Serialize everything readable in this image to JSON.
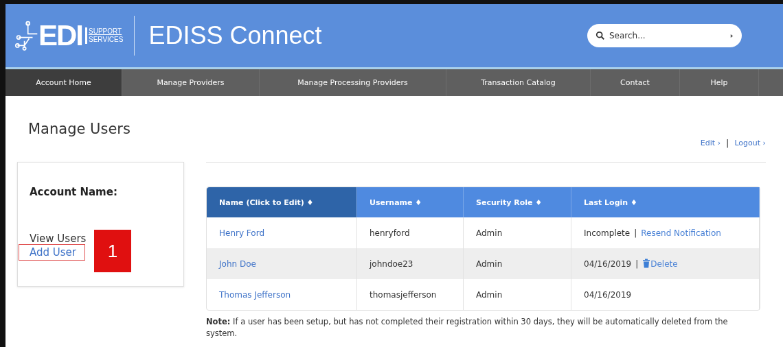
{
  "header": {
    "logo": {
      "main": "EDI",
      "line_1": "SUPPORT",
      "line_2": "SERVICES"
    },
    "title": "EDISS Connect",
    "search": {
      "placeholder": "Search..."
    }
  },
  "nav": [
    {
      "label": "Account Home",
      "selected": true
    },
    {
      "label": "Manage Providers",
      "selected": false
    },
    {
      "label": "Manage Processing Providers",
      "selected": false
    },
    {
      "label": "Transaction Catalog",
      "selected": false
    },
    {
      "label": "Contact",
      "selected": false
    },
    {
      "label": "Help",
      "selected": false
    }
  ],
  "page_title": "Manage Users",
  "top_links": [
    "Edit ›",
    "Logout ›"
  ],
  "top_links_separator": "|",
  "sidebar": {
    "account_label": "Account Name:",
    "links": [
      {
        "label": "View Users",
        "kind": "text",
        "highlighted": false
      },
      {
        "label": "Add User",
        "kind": "link",
        "highlighted": true
      }
    ]
  },
  "callout": "1",
  "table": {
    "columns": [
      {
        "label": "Name (Click to Edit) ♦",
        "selected": true
      },
      {
        "label": "Username ♦",
        "selected": false
      },
      {
        "label": "Security Role ♦",
        "selected": false
      },
      {
        "label": "Last Login ♦",
        "selected": false
      }
    ],
    "rows": [
      {
        "name": "Henry Ford",
        "username": "henryford",
        "role": "Admin",
        "last_login": "Incomplete",
        "action": {
          "kind": "resend",
          "label": "Resend Notification"
        }
      },
      {
        "name": "John Doe",
        "username": "johndoe23",
        "role": "Admin",
        "last_login": "04/16/2019",
        "action": {
          "kind": "delete",
          "label": "Delete"
        }
      },
      {
        "name": "Thomas Jefferson",
        "username": "thomasjefferson",
        "role": "Admin",
        "last_login": "04/16/2019"
      }
    ],
    "action_separator": "|"
  },
  "note": "**Note:** If a user has been setup, but has not completed their registration within 30 days, they will be automatically deleted from the system."
}
